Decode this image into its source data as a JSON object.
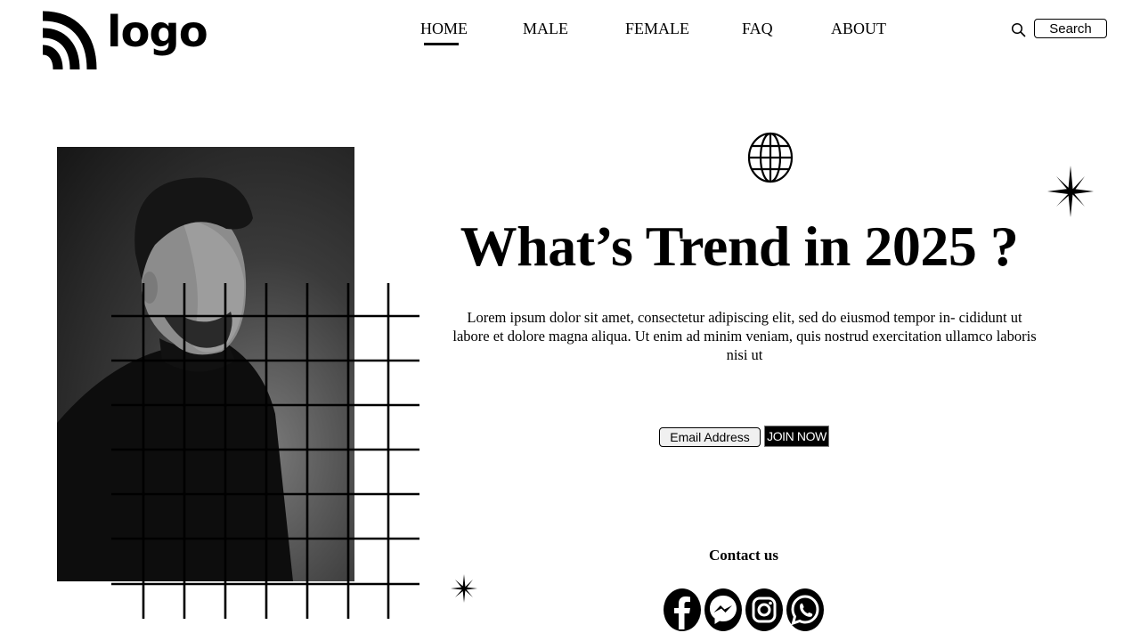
{
  "brand": {
    "logo_text": "logo"
  },
  "nav": {
    "items": [
      {
        "label": "HOME",
        "active": true
      },
      {
        "label": "MALE",
        "active": false
      },
      {
        "label": "FEMALE",
        "active": false
      },
      {
        "label": "FAQ",
        "active": false
      },
      {
        "label": "ABOUT",
        "active": false
      }
    ]
  },
  "search": {
    "icon": "search-icon",
    "button_label": "Search"
  },
  "hero": {
    "icon": "globe-icon",
    "title": "What’s Trend in 2025 ?",
    "body": "Lorem ipsum dolor sit amet, consectetur adipiscing elit, sed do eiusmod tempor in- cididunt ut labore et dolore magna aliqua. Ut enim ad minim veniam, quis nostrud exercitation ullamco laboris nisi ut",
    "image_alt": "Black and white portrait of a man in a dark jacket"
  },
  "signup": {
    "email_placeholder": "Email Address",
    "join_label": "JOIN NOW"
  },
  "contact": {
    "title": "Contact us",
    "socials": [
      {
        "name": "facebook-icon"
      },
      {
        "name": "messenger-icon"
      },
      {
        "name": "instagram-icon"
      },
      {
        "name": "whatsapp-icon"
      }
    ]
  }
}
